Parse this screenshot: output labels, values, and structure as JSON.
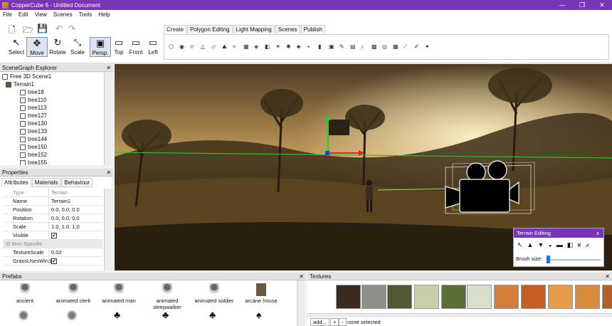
{
  "window": {
    "title": "CopperCube 6 - Untitled Document",
    "min": "—",
    "max": "❐",
    "close": "✕"
  },
  "menu": [
    "File",
    "Edit",
    "View",
    "Scenes",
    "Tools",
    "Help"
  ],
  "toolbar": {
    "buttons": [
      {
        "name": "select-tool",
        "label": "Select",
        "icon": "↖"
      },
      {
        "name": "move-tool",
        "label": "Move",
        "icon": "✥"
      },
      {
        "name": "rotate-tool",
        "label": "Rotate",
        "icon": "↻"
      },
      {
        "name": "scale-tool",
        "label": "Scale",
        "icon": "⤡"
      }
    ],
    "views": [
      {
        "name": "persp-view",
        "label": "Persp.",
        "icon": "▣"
      },
      {
        "name": "top-view",
        "label": "Top",
        "icon": "▭"
      },
      {
        "name": "front-view",
        "label": "Front",
        "icon": "▭"
      },
      {
        "name": "left-view",
        "label": "Left",
        "icon": "▭"
      }
    ]
  },
  "tabs": [
    "Create",
    "Polygon Editing",
    "Light Mapping",
    "Scenes",
    "Publish"
  ],
  "scenegraph": {
    "title": "SceneGraph Explorer",
    "items": [
      "Free 3D Scene1",
      "Terrain1",
      "tree18",
      "tree110",
      "tree113",
      "tree127",
      "tree130",
      "tree133",
      "tree144",
      "tree150",
      "tree152",
      "tree155"
    ]
  },
  "properties": {
    "title": "Properties",
    "tabs": [
      "Attributes",
      "Materials",
      "Behaviour"
    ],
    "rows": [
      {
        "key": "Type",
        "value": "Terrain"
      },
      {
        "key": "Name",
        "value": "Terrain1"
      },
      {
        "key": "Position",
        "value": "0.0, 0.0, 0.0"
      },
      {
        "key": "Rotation",
        "value": "0.0, 0.0, 0.0"
      },
      {
        "key": "Scale",
        "value": "1.0, 1.0, 1.0"
      },
      {
        "key": "Visible",
        "value": "✔"
      },
      {
        "key": "Item Specific",
        "value": ""
      },
      {
        "key": "TextureScale",
        "value": "0.02"
      },
      {
        "key": "GrassUsesWind",
        "value": "✔"
      }
    ]
  },
  "terrain_editing": {
    "title": "Terrain Editing",
    "brush_label": "Brush size:",
    "close": "x"
  },
  "prefabs": {
    "title": "Prefabs",
    "items": [
      "ancient",
      "animated clerk",
      "animated man",
      "animated sleepwalker",
      "animated soldier",
      "arcane house"
    ]
  },
  "textures": {
    "title": "Textures",
    "add": "add...",
    "plus": "+",
    "minus": "-",
    "status": "none selected",
    "colors": [
      "#3a2b20",
      "#8f8f8a",
      "#4f5a33",
      "#c7cfa8",
      "#5b6e35",
      "#d9dfc8",
      "#d37e3a",
      "#c65d22",
      "#e69b4a",
      "#d88a3d",
      "#b45f2a"
    ]
  },
  "colors": {
    "accent": "#7a35b6"
  }
}
